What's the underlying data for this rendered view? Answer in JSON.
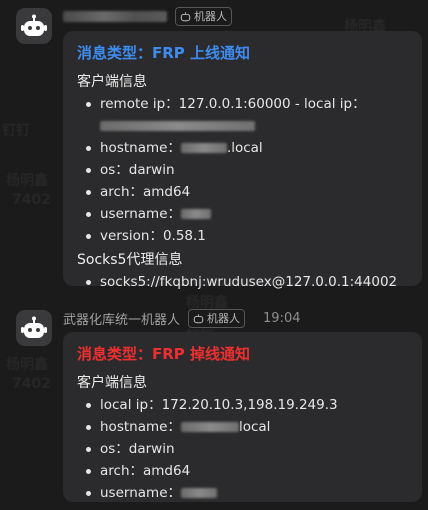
{
  "watermark": {
    "name": "杨明鑫",
    "code": "7402",
    "tag": "钉钉"
  },
  "messages": [
    {
      "sender": "",
      "bot_tag": "机器人",
      "time": "",
      "title": "消息类型：FRP 上线通知",
      "title_color": "#3d8cf0",
      "client_section": "客户端信息",
      "client_items": [
        {
          "label": "remote ip：127.0.0.1:60000 - local ip："
        },
        {
          "label": "hostname：",
          "suffix": ".local"
        },
        {
          "label": "os：darwin"
        },
        {
          "label": "arch：amd64"
        },
        {
          "label": "username："
        },
        {
          "label": "version：0.58.1"
        }
      ],
      "socks_section": "Socks5代理信息",
      "socks_items": [
        {
          "label": "socks5://fkqbnj:wrudusex@127.0.0.1:44002"
        }
      ]
    },
    {
      "sender": "武器化库统一机器人",
      "bot_tag": "机器人",
      "time": "19:04",
      "title": "消息类型：FRP 掉线通知",
      "title_color": "#ef2f2f",
      "client_section": "客户端信息",
      "client_items": [
        {
          "label": "local ip：172.20.10.3,198.19.249.3"
        },
        {
          "label": "hostname：",
          "suffix": "local"
        },
        {
          "label": "os：darwin"
        },
        {
          "label": "arch：amd64"
        },
        {
          "label": "username："
        }
      ]
    }
  ]
}
